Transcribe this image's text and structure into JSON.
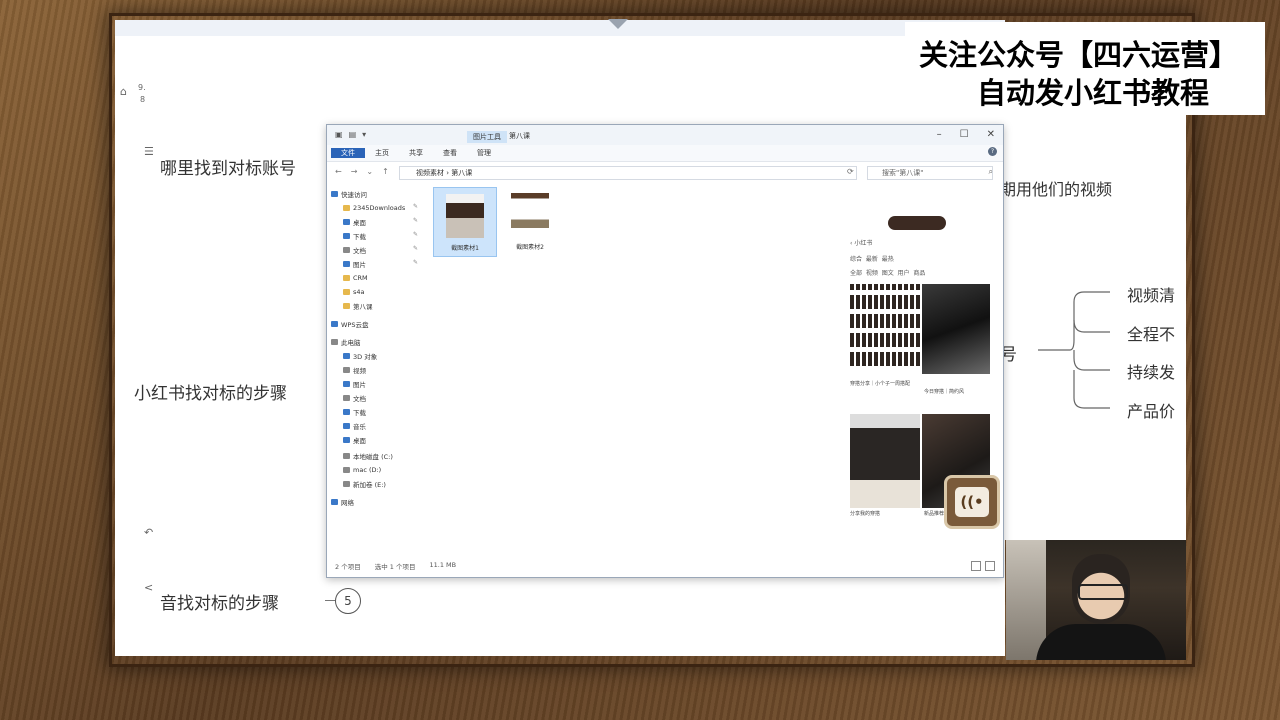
{
  "banner": {
    "line1": "关注公众号【四六运营】",
    "line2": "自动发小红书教程"
  },
  "mindmap": {
    "node_top": "哪里找到对标账号",
    "node_middle": "小红书找对标的步骤",
    "node_bottom": "音找对标的步骤",
    "node_bottom_num": "5",
    "right_top_text": "期用他们的视频",
    "right_node": "号",
    "branches": [
      "视频清",
      "全程不",
      "持续发",
      "产品价"
    ]
  },
  "left_toolbar": {
    "icon1_label": "9.",
    "icon1_sub": "8"
  },
  "explorer": {
    "title": "第八课",
    "tab_label": "图片工具",
    "ribbon": [
      "文件",
      "主页",
      "共享",
      "查看",
      "管理"
    ],
    "address": "视频素材 › 第八课",
    "search_placeholder": "搜索\"第八课\"",
    "nav": [
      {
        "label": "快速访问",
        "icon": "star-icon"
      },
      {
        "label": "2345Downloads",
        "icon": "folder-icon"
      },
      {
        "label": "桌面",
        "icon": "desktop-icon"
      },
      {
        "label": "下载",
        "icon": "download-icon"
      },
      {
        "label": "文档",
        "icon": "document-icon"
      },
      {
        "label": "图片",
        "icon": "pictures-icon"
      },
      {
        "label": "CRM",
        "icon": "folder-icon"
      },
      {
        "label": "s4a",
        "icon": "folder-icon"
      },
      {
        "label": "第八课",
        "icon": "folder-icon"
      },
      {
        "label": "WPS云盘",
        "icon": "cloud-icon"
      },
      {
        "label": "此电脑",
        "icon": "computer-icon"
      },
      {
        "label": "3D 对象",
        "icon": "cube-icon"
      },
      {
        "label": "视频",
        "icon": "video-icon"
      },
      {
        "label": "图片",
        "icon": "pictures-icon"
      },
      {
        "label": "文档",
        "icon": "document-icon"
      },
      {
        "label": "下载",
        "icon": "download-icon"
      },
      {
        "label": "音乐",
        "icon": "music-icon"
      },
      {
        "label": "桌面",
        "icon": "desktop-icon"
      },
      {
        "label": "本地磁盘 (C:)",
        "icon": "drive-icon"
      },
      {
        "label": "mac (D:)",
        "icon": "drive-icon"
      },
      {
        "label": "新加卷 (E:)",
        "icon": "drive-icon"
      },
      {
        "label": "网络",
        "icon": "network-icon"
      }
    ],
    "files": [
      {
        "name": "截图素材1"
      },
      {
        "name": "截图素材2"
      }
    ],
    "status": {
      "count": "2 个项目",
      "selected": "选中 1 个项目",
      "size": "11.1 MB"
    }
  },
  "preview": {
    "search_text": "小红书",
    "tabs": [
      "综合",
      "最新",
      "最热"
    ],
    "filters": [
      "全部",
      "视频",
      "图文",
      "用户",
      "商品"
    ],
    "caption1": "穿搭分享｜小个子一周搭配",
    "caption2": "今日穿搭｜简约风",
    "caption3": "分享我的穿搭",
    "caption4": "新品推荐"
  },
  "colors": {
    "frame": "#6b4a2b",
    "ribbon_active": "#2b64b8",
    "selection": "#cde4fb"
  }
}
